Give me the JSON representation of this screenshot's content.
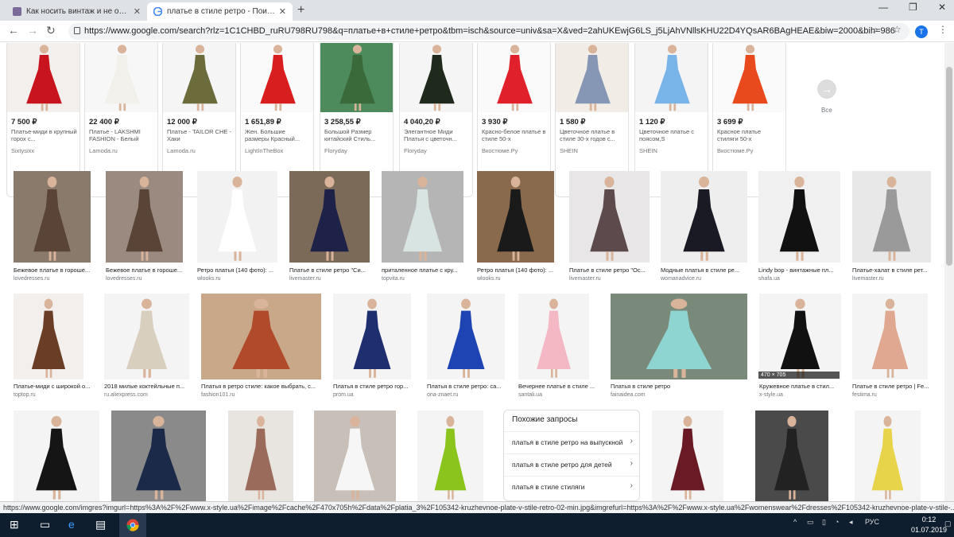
{
  "tabs": [
    {
      "title": "Как носить винтаж и не облаж"
    },
    {
      "title": "платье в стиле ретро - Поиск в"
    }
  ],
  "address": {
    "url": "https://www.google.com/search?rlz=1C1CHBD_ruRU798RU798&q=платье+в+стиле+ретро&tbm=isch&source=univ&sa=X&ved=2ahUKEwjG6LS_j5LjAhVNllsKHU22D4YQsAR6BAgHEAE&biw=2000&bih=986"
  },
  "profile": {
    "initial": "T"
  },
  "shopping": [
    {
      "price": "7 500 ₽",
      "desc": "Платье-миди в крупный горох с...",
      "src": "Sixtysixx",
      "bg": "#f3efec",
      "col": "#c8141e"
    },
    {
      "price": "22 400 ₽",
      "desc": "Платье - LAKSHMI FASHION - Белый",
      "src": "Lamoda.ru",
      "bg": "#f7f7f7",
      "col": "#f2f0ea"
    },
    {
      "price": "12 000 ₽",
      "desc": "Платье - TAILOR CHE - Хаки",
      "src": "Lamoda.ru",
      "bg": "#f5f5f5",
      "col": "#6b6b3c"
    },
    {
      "price": "1 651,89 ₽",
      "desc": "Жен. Большие размеры Красный...",
      "src": "LightInTheBox",
      "bg": "#fafafa",
      "col": "#d81e1e"
    },
    {
      "price": "3 258,55 ₽",
      "desc": "Большой Размер китайский Стиль...",
      "src": "Floryday",
      "bg": "#4d8a5c",
      "col": "#3a6a3a"
    },
    {
      "price": "4 040,20 ₽",
      "desc": "Элегантное Миди Платья с цветочн...",
      "src": "Floryday",
      "bg": "#f5f5f5",
      "col": "#1f2a1c"
    },
    {
      "price": "3 930 ₽",
      "desc": "Красно-белое платье в стиле 50-х",
      "src": "Вкостюме.Ру",
      "bg": "#fafafa",
      "col": "#e0202a"
    },
    {
      "price": "1 580 ₽",
      "desc": "Цветочное платье в стиле 30-х годов с...",
      "src": "SHEIN",
      "bg": "#f1ede6",
      "col": "#8597b4"
    },
    {
      "price": "1 120 ₽",
      "desc": "Цветочное платье с поясом,S",
      "src": "SHEIN",
      "bg": "#f4f4f4",
      "col": "#79b4e8"
    },
    {
      "price": "3 699 ₽",
      "desc": "Красное платье стиляги 50-х",
      "src": "Вкостюме.Ру",
      "bg": "#fafafa",
      "col": "#e84a1e"
    }
  ],
  "all_label": "Все",
  "grid_row1": [
    {
      "cap": "Бежевое платье в гороше...",
      "dom": "lovedresses.ru",
      "bg": "#8a7a6c",
      "col": "#5a4438"
    },
    {
      "cap": "Бежевое платье в гороше...",
      "dom": "lovedresses.ru",
      "bg": "#9a8a80",
      "col": "#5a4438"
    },
    {
      "cap": "Ретро платья (140 фото): ...",
      "dom": "wlooks.ru",
      "bg": "#f2f2f2",
      "col": "#ffffff"
    },
    {
      "cap": "Платье в стиле ретро \"Си...",
      "dom": "livemaster.ru",
      "bg": "#7c6a58",
      "col": "#1e2248"
    },
    {
      "cap": "приталенное платье с кру...",
      "dom": "topvita.ru",
      "bg": "#b5b5b5",
      "col": "#d8e4e2"
    },
    {
      "cap": "Ретро платья (140 фото): ...",
      "dom": "wlooks.ru",
      "bg": "#8a6a4c",
      "col": "#1a1a1a"
    },
    {
      "cap": "Платье в стиле ретро \"Ос...",
      "dom": "livemaster.ru",
      "bg": "#e8e6e6",
      "col": "#5c4a4c"
    },
    {
      "cap": "Модные платья в стиле ре...",
      "dom": "womanadvice.ru",
      "bg": "#eeeeee",
      "col": "#1a1a24"
    },
    {
      "cap": "Lindy bop - винтажные пл...",
      "dom": "shafa.ua",
      "bg": "#f0f0f0",
      "col": "#111111"
    },
    {
      "cap": "Платье-халат в стиле рет...",
      "dom": "livemaster.ru",
      "bg": "#e8e8e8",
      "col": "#9a9a9a"
    }
  ],
  "grid_row2": [
    {
      "cap": "Платье-миди с широкой о...",
      "dom": "toptop.ru",
      "bg": "#f2efec",
      "col": "#6a3e26"
    },
    {
      "cap": "2018 милые коктейльные п...",
      "dom": "ru.aliexpress.com",
      "bg": "#f4f4f4",
      "col": "#d9cfbe"
    },
    {
      "cap": "Платья в ретро стиле: какое выбрать, с...",
      "dom": "fashion101.ru",
      "bg": "#c8a888",
      "col": "#b04a2a"
    },
    {
      "cap": "Платья в стиле ретро гор...",
      "dom": "prom.ua",
      "bg": "#f4f4f4",
      "col": "#1e2e6e"
    },
    {
      "cap": "Платья в стиле ретро: са...",
      "dom": "ona-znaet.ru",
      "bg": "#f4f4f4",
      "col": "#1e44b4"
    },
    {
      "cap": "Вечернее платье в стиле ...",
      "dom": "santali.ua",
      "bg": "#f4f4f4",
      "col": "#f4b8c4"
    },
    {
      "cap": "Платья в стиле ретро",
      "dom": "fainaidea.com",
      "bg": "#7a8a7a",
      "col": "#8ed4d0"
    },
    {
      "cap": "Кружевное платье в стил...",
      "dom": "x-style.ua",
      "bg": "#f4f4f4",
      "col": "#111111"
    },
    {
      "cap": "Платье в стиле ретро | Fe...",
      "dom": "festima.ru",
      "bg": "#f4f4f4",
      "col": "#e0a890"
    }
  ],
  "grid_row3": [
    {
      "bg": "#f4f4f4",
      "col": "#151515"
    },
    {
      "bg": "#8a8a8a",
      "col": "#1c2a4a"
    },
    {
      "bg": "#e8e4e0",
      "col": "#9a6a5a"
    },
    {
      "bg": "#c8c0b8",
      "col": "#f6f6f6"
    },
    {
      "bg": "#f4f4f4",
      "col": "#8cc41e"
    },
    {
      "bg": "#f4f4f4",
      "col": "#6a1a24"
    },
    {
      "bg": "#4a4a4a",
      "col": "#222222"
    },
    {
      "bg": "#f4f4f4",
      "col": "#e8d44a"
    }
  ],
  "dimensions_overlay": "470 × 705",
  "related": {
    "title": "Похожие запросы",
    "items": [
      "платья в стиле ретро на выпускной",
      "платья в стиле ретро для детей",
      "платья в стиле стиляги"
    ]
  },
  "status_url": "https://www.google.com/imgres?imgurl=https%3A%2F%2Fwww.x-style.ua%2Fimage%2Fcache%2F470x705h%2Fdata%2Fplatia_3%2F105342-kruzhevnoe-plate-v-stile-retro-02-min.jpg&imgrefurl=https%3A%2F%2Fwww.x-style.ua%2Fwomenswear%2Fdresses%2F105342-kruzhevnoe-plate-v-stile-...",
  "tray": {
    "lang": "РУС",
    "time": "0:12",
    "date": "01.07.2019"
  }
}
